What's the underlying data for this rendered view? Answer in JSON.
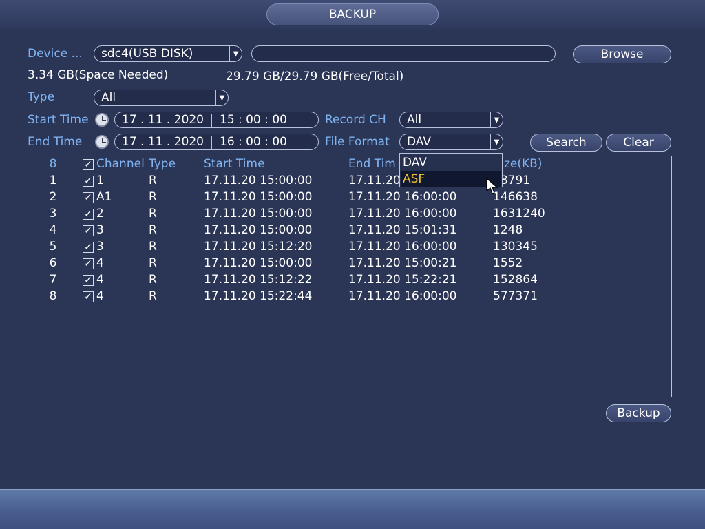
{
  "window": {
    "title": "BACKUP"
  },
  "device": {
    "label": "Device ...",
    "value": "sdc4(USB DISK)",
    "path": "",
    "browse_label": "Browse",
    "space_needed": "3.34 GB(Space Needed)",
    "free_total": "29.79 GB/29.79 GB(Free/Total)"
  },
  "type": {
    "label": "Type",
    "value": "All"
  },
  "start_time": {
    "label": "Start Time",
    "date": "17 . 11 . 2020",
    "time": "15 : 00 : 00"
  },
  "end_time": {
    "label": "End Time",
    "date": "17 . 11 . 2020",
    "time": "16 : 00 : 00"
  },
  "record_ch": {
    "label": "Record CH",
    "value": "All"
  },
  "file_format": {
    "label": "File Format",
    "value": "DAV",
    "options": [
      "DAV",
      "ASF"
    ],
    "highlighted": "ASF"
  },
  "buttons": {
    "search": "Search",
    "clear": "Clear",
    "backup": "Backup"
  },
  "table": {
    "count": "8",
    "headers": {
      "channel": "Channel",
      "type": "Type",
      "start": "Start Time",
      "end": "End Time",
      "size": "Size(KB)"
    },
    "header_visible": {
      "end": "End Tim",
      "size": "ze(KB)"
    },
    "rows": [
      {
        "idx": "1",
        "channel": "1",
        "type": "R",
        "start": "17.11.20 15:00:00",
        "end": "17.11.20",
        "size": "58791"
      },
      {
        "idx": "2",
        "channel": "A1",
        "type": "R",
        "start": "17.11.20 15:00:00",
        "end": "17.11.20 16:00:00",
        "size": "146638"
      },
      {
        "idx": "3",
        "channel": "2",
        "type": "R",
        "start": "17.11.20 15:00:00",
        "end": "17.11.20 16:00:00",
        "size": "1631240"
      },
      {
        "idx": "4",
        "channel": "3",
        "type": "R",
        "start": "17.11.20 15:00:00",
        "end": "17.11.20 15:01:31",
        "size": "1248"
      },
      {
        "idx": "5",
        "channel": "3",
        "type": "R",
        "start": "17.11.20 15:12:20",
        "end": "17.11.20 16:00:00",
        "size": "130345"
      },
      {
        "idx": "6",
        "channel": "4",
        "type": "R",
        "start": "17.11.20 15:00:00",
        "end": "17.11.20 15:00:21",
        "size": "1552"
      },
      {
        "idx": "7",
        "channel": "4",
        "type": "R",
        "start": "17.11.20 15:12:22",
        "end": "17.11.20 15:22:21",
        "size": "152864"
      },
      {
        "idx": "8",
        "channel": "4",
        "type": "R",
        "start": "17.11.20 15:22:44",
        "end": "17.11.20 16:00:00",
        "size": "577371"
      }
    ]
  },
  "icons": {
    "clock": "clock-icon",
    "checkbox": "checkbox-checked-icon",
    "dropdown": "chevron-down-icon",
    "cursor": "mouse-pointer-icon"
  },
  "colors": {
    "background": "#2b3556",
    "label": "#7fb3f0",
    "highlight": "#f2c230",
    "border": "#b8c2dc"
  }
}
